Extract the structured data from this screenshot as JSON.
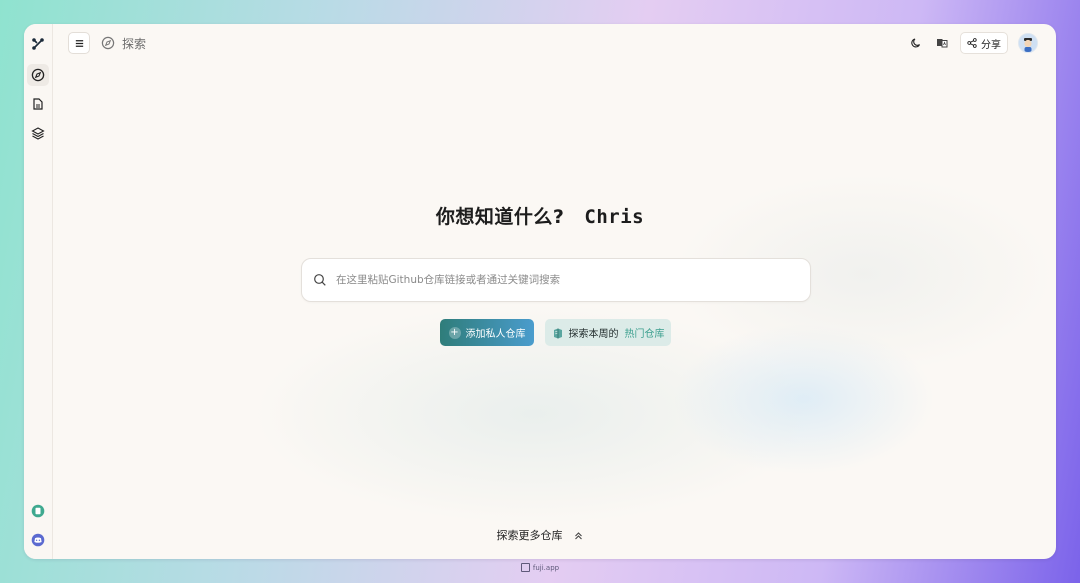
{
  "header": {
    "breadcrumb_label": "探索",
    "share_label": "分享"
  },
  "hero": {
    "question": "你想知道什么?",
    "user_name": "Chris"
  },
  "search": {
    "placeholder": "在这里粘贴Github仓库链接或者通过关键词搜索"
  },
  "actions": {
    "add_private_label": "添加私人仓库",
    "explore_weekly_label": "探索本周的",
    "hot_repos_label": "热门仓库"
  },
  "bottom": {
    "explore_more_label": "探索更多仓库"
  },
  "footer": {
    "brand": "fuji.app"
  },
  "icons": {
    "sidebar": [
      "logo-icon",
      "compass-icon",
      "document-icon",
      "layers-icon",
      "app-icon",
      "discord-icon"
    ],
    "topbar": [
      "menu-icon",
      "compass-icon",
      "moon-icon",
      "translate-icon",
      "share-icon",
      "avatar"
    ]
  },
  "colors": {
    "accent_teal": "#2f7d7a",
    "accent_blue": "#4a9ccd",
    "highlight": "#3b9f8e",
    "background": "#fbf8f4"
  }
}
